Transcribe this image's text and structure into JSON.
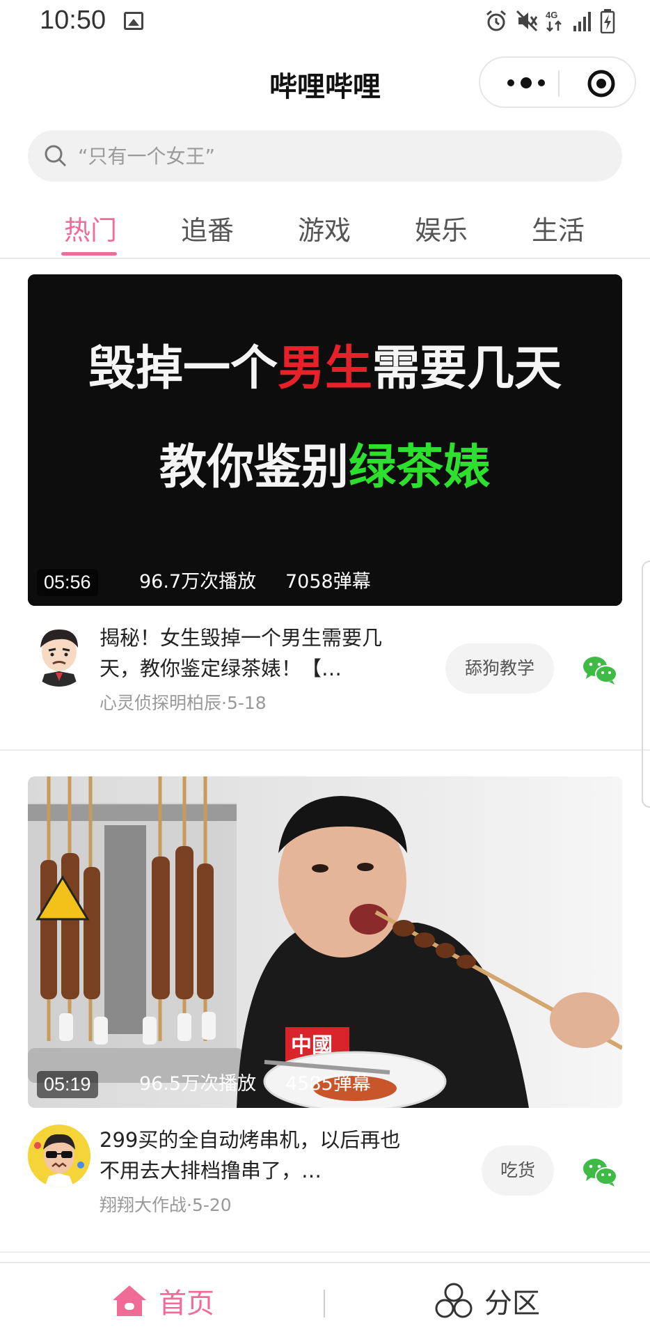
{
  "status": {
    "time": "10:50",
    "network": "4G"
  },
  "header": {
    "title": "哔哩哔哩"
  },
  "search": {
    "placeholder": "“只有一个女王”"
  },
  "tabs": [
    {
      "label": "热门",
      "active": true
    },
    {
      "label": "追番",
      "active": false
    },
    {
      "label": "游戏",
      "active": false
    },
    {
      "label": "娱乐",
      "active": false
    },
    {
      "label": "生活",
      "active": false
    }
  ],
  "videos": [
    {
      "thumb_line1_white": "毁掉一个",
      "thumb_line1_red": "男生",
      "thumb_line1_white2": "需要几天",
      "thumb_line2_white": "教你鉴别",
      "thumb_line2_green": "绿茶婊",
      "duration": "05:56",
      "views": "96.7万次播放",
      "danmaku": "7058弹幕",
      "title": "揭秘！女生毁掉一个男生需要几天，教你鉴定绿茶婊！【…",
      "author_date": "心灵侦探明柏辰·5-18",
      "tag": "舔狗教学"
    },
    {
      "duration": "05:19",
      "views": "96.5万次播放",
      "danmaku": "4585弹幕",
      "thumb_shirt_text": "中國",
      "title": "299买的全自动烤串机，以后再也不用去大排档撸串了，…",
      "author_date": "翔翔大作战·5-20",
      "tag": "吃货"
    }
  ],
  "bottom_nav": [
    {
      "label": "首页",
      "active": true
    },
    {
      "label": "分区",
      "active": false
    }
  ],
  "colors": {
    "accent": "#f06c96",
    "wechat": "#3dbb45"
  }
}
